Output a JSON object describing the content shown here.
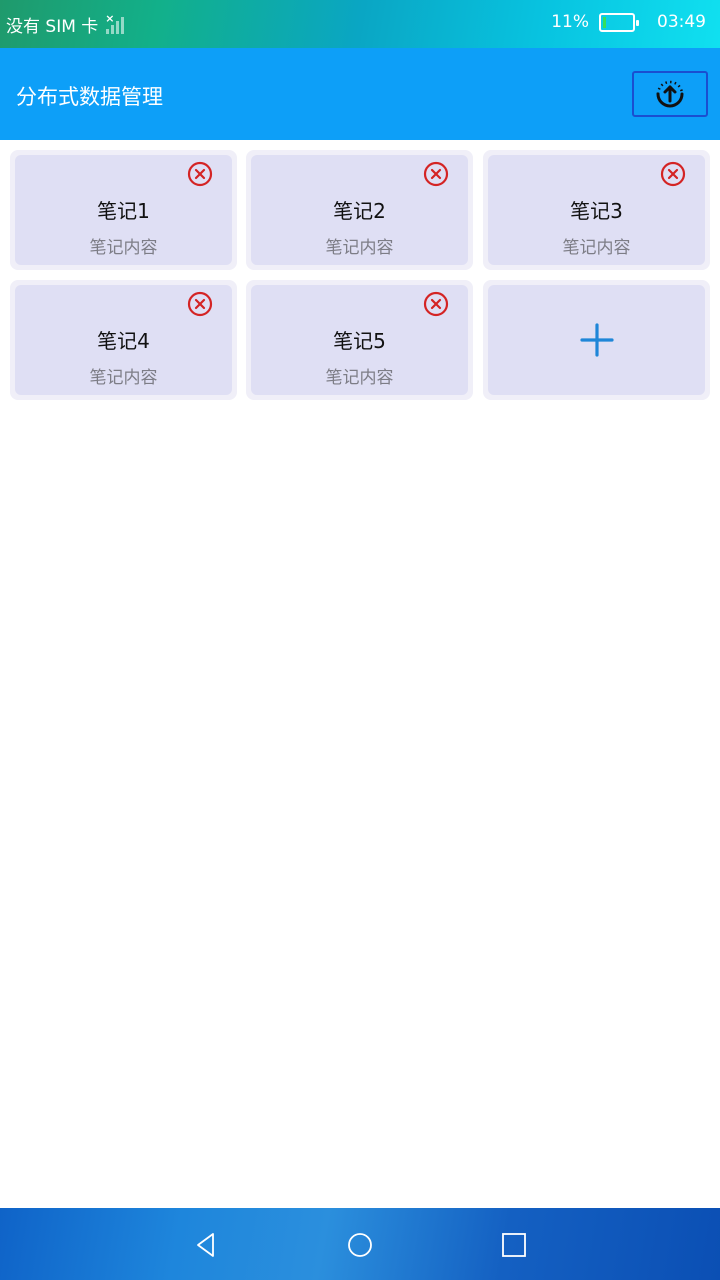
{
  "status_bar": {
    "carrier": "没有 SIM 卡",
    "battery_percent": "11%",
    "battery_level": 0.11,
    "time": "03:49"
  },
  "header": {
    "title": "分布式数据管理",
    "sync_icon": "sync-upload-icon"
  },
  "notes": [
    {
      "title": "笔记1",
      "content": "笔记内容"
    },
    {
      "title": "笔记2",
      "content": "笔记内容"
    },
    {
      "title": "笔记3",
      "content": "笔记内容"
    },
    {
      "title": "笔记4",
      "content": "笔记内容"
    },
    {
      "title": "笔记5",
      "content": "笔记内容"
    }
  ],
  "add_card": {
    "icon": "plus-icon"
  },
  "colors": {
    "header_bg": "#0d9ff8",
    "card_bg": "#dfdff4",
    "delete_red": "#d42424",
    "add_blue": "#1f86d8"
  },
  "nav": {
    "icons": [
      "back-triangle-icon",
      "home-circle-icon",
      "recent-square-icon"
    ]
  }
}
